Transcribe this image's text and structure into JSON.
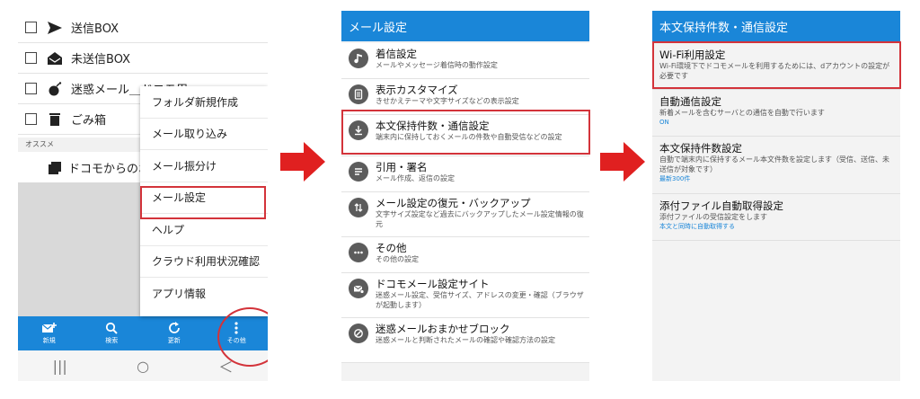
{
  "screen1": {
    "folders": [
      {
        "label": "送信BOX",
        "icon": "send-icon"
      },
      {
        "label": "未送信BOX",
        "icon": "envelope-open-icon"
      },
      {
        "label": "迷惑メール＿ドコモ用",
        "icon": "bomb-icon"
      },
      {
        "label": "ごみ箱",
        "icon": "trash-icon"
      }
    ],
    "section_label": "オススメ",
    "docomo_item": "ドコモからのお知らせ",
    "menu": [
      "フォルダ新規作成",
      "メール取り込み",
      "メール振分け",
      "メール設定",
      "ヘルプ",
      "クラウド利用状況確認",
      "アプリ情報"
    ],
    "bottom_bar": [
      {
        "label": "新規",
        "icon": "compose-icon"
      },
      {
        "label": "検索",
        "icon": "search-icon"
      },
      {
        "label": "更新",
        "icon": "refresh-icon"
      },
      {
        "label": "その他",
        "icon": "more-vertical-icon"
      }
    ],
    "nav": [
      "|||",
      "○",
      "＜"
    ]
  },
  "screen2": {
    "title": "メール設定",
    "items": [
      {
        "title": "着信設定",
        "desc": "メールやメッセージ着信時の動作設定",
        "icon": "music-note-icon"
      },
      {
        "title": "表示カスタマイズ",
        "desc": "きせかえテーマや文字サイズなどの表示設定",
        "icon": "display-icon"
      },
      {
        "title": "本文保持件数・通信設定",
        "desc": "端末内に保持しておくメールの件数や自動受信などの設定",
        "icon": "download-icon"
      },
      {
        "title": "引用・署名",
        "desc": "メール作成、返信の設定",
        "icon": "quote-icon"
      },
      {
        "title": "メール設定の復元・バックアップ",
        "desc": "文字サイズ設定など過去にバックアップしたメール設定情報の復元",
        "icon": "backup-icon"
      },
      {
        "title": "その他",
        "desc": "その他の設定",
        "icon": "more-icon"
      },
      {
        "title": "ドコモメール設定サイト",
        "desc": "迷惑メール設定、受信サイズ、アドレスの変更・確認（ブラウザが起動します）",
        "icon": "mail-settings-icon"
      },
      {
        "title": "迷惑メールおまかせブロック",
        "desc": "迷惑メールと判断されたメールの確認や確認方法の設定",
        "icon": "block-icon"
      }
    ]
  },
  "screen3": {
    "title": "本文保持件数・通信設定",
    "options": [
      {
        "title": "Wi-Fi利用設定",
        "desc": "Wi-Fi環境下でドコモメールを利用するためには、dアカウントの設定が必要です",
        "value": ""
      },
      {
        "title": "自動通信設定",
        "desc": "新着メールを含むサーバとの通信を自動で行います",
        "value": "ON"
      },
      {
        "title": "本文保持件数設定",
        "desc": "自動で端末内に保持するメール本文件数を設定します（受信、送信、未送信が対象です）",
        "value": "最新300件"
      },
      {
        "title": "添付ファイル自動取得設定",
        "desc": "添付ファイルの受信設定をします",
        "value": "本文と同時に自動取得する"
      }
    ]
  },
  "colors": {
    "brand_blue": "#1a86d8",
    "highlight_red": "#d3333a",
    "arrow_red": "#e02020"
  }
}
